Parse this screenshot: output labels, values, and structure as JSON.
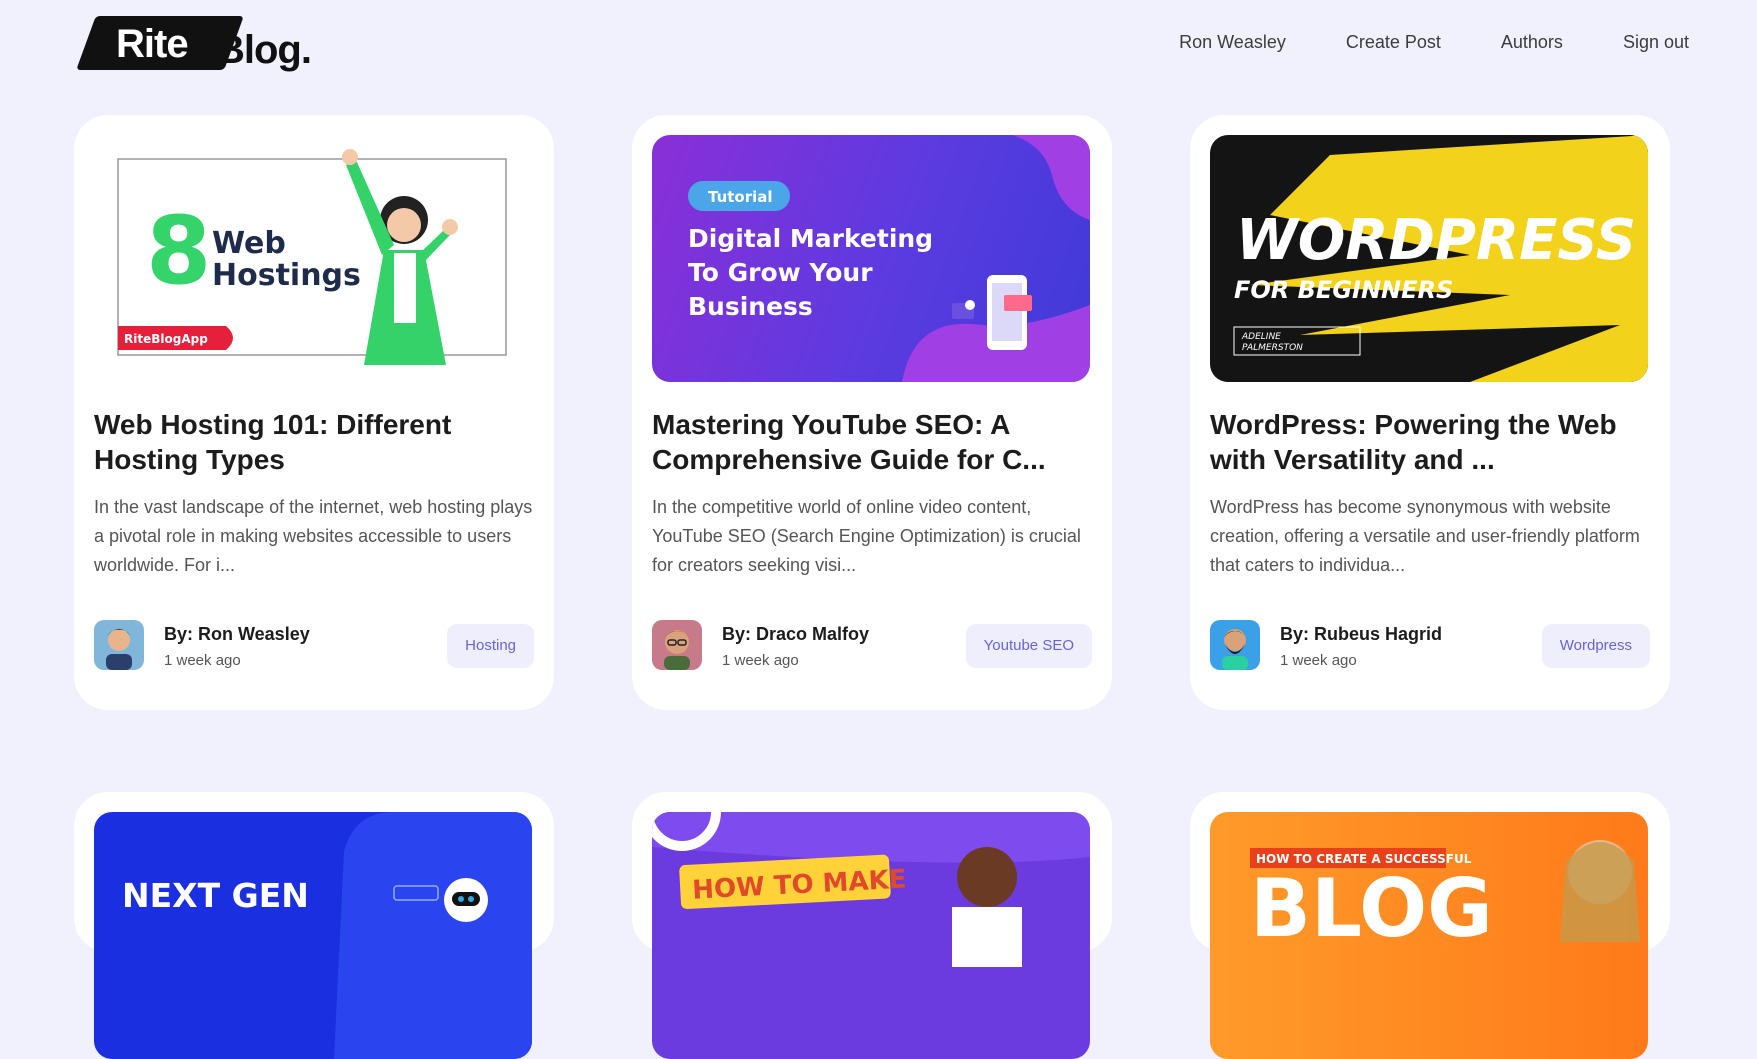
{
  "header": {
    "logo": {
      "part1": "Rite",
      "part2": "Blog."
    },
    "nav": [
      "Ron Weasley",
      "Create Post",
      "Authors",
      "Sign out"
    ]
  },
  "posts": [
    {
      "title": "Web Hosting 101: Different Hosting Types",
      "excerpt": "In the vast landscape of the internet, web hosting plays a pivotal role in making websites accessible to users worldwide. For i...",
      "author": "By: Ron Weasley",
      "time": "1 week ago",
      "tag": "Hosting",
      "thumb": {
        "number": "8",
        "line1": "Web",
        "line2": "Hostings",
        "badge": "RiteBlogApp"
      }
    },
    {
      "title": "Mastering YouTube SEO: A Comprehensive Guide for C...",
      "excerpt": "In the competitive world of online video content, YouTube SEO (Search Engine Optimization) is crucial for creators seeking visi...",
      "author": "By: Draco Malfoy",
      "time": "1 week ago",
      "tag": "Youtube SEO",
      "thumb": {
        "pill": "Tutorial",
        "line1": "Digital Marketing",
        "line2": "To Grow Your",
        "line3": "Business"
      }
    },
    {
      "title": "WordPress: Powering the Web with Versatility and ...",
      "excerpt": "WordPress has become synonymous with website creation, offering a versatile and user-friendly platform that caters to individua...",
      "author": "By: Rubeus Hagrid",
      "time": "1 week ago",
      "tag": "Wordpress",
      "thumb": {
        "line1": "WORDPRESS",
        "line2": "FOR BEGINNERS",
        "line3": "ADELINE",
        "line4": "PALMERSTON"
      }
    }
  ],
  "second_row": [
    {
      "thumb_text": "NEXT GEN"
    },
    {
      "thumb_text": "HOW TO MAKE"
    },
    {
      "thumb_text": "HOW TO CREATE A SUCCESSFUL",
      "big": "BLOG"
    }
  ],
  "colors": {
    "background": "#f1f1fd",
    "accent": "#6a63d8",
    "tag_bg": "#eeeefc"
  }
}
